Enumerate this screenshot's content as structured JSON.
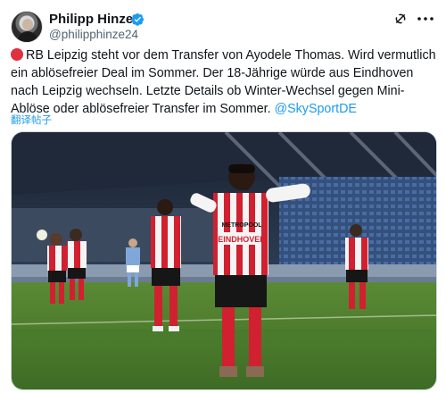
{
  "author": {
    "display_name": "Philipp Hinze",
    "handle": "@philipphinze24",
    "verified": true,
    "avatar_icon": "user-avatar-icon"
  },
  "actions": {
    "grok_icon": "grok-icon",
    "more_icon": "more-dots-icon"
  },
  "tweet": {
    "status_icon": "red-circle-icon",
    "text": "RB Leipzig steht vor dem Transfer von Ayodele Thomas. Wird vermutlich ein ablösefreier Deal im Sommer. Der 18-Jährige würde aus Eindhoven nach Leipzig wechseln. Letzte Details ob Winter-Wechsel gegen Mini-Ablöse oder ablösefreier Transfer im Sommer. ",
    "mention": "@SkySportDE",
    "translate_label": "翻译帖子"
  },
  "media": {
    "description_icon": "football-photo",
    "shirt_text": "EINDHOVEN",
    "shirt_brand": "METROPOOL",
    "colors": {
      "pitch": "#4f7d2e",
      "shirt_red": "#d1202f",
      "shirt_white": "#f4f4f4",
      "shorts": "#161616",
      "stands_blue": "#3b5a8c"
    }
  },
  "colors": {
    "link": "#1d9bf0",
    "verified": "#1d9bf0",
    "text": "#0f1419",
    "muted": "#536471"
  }
}
